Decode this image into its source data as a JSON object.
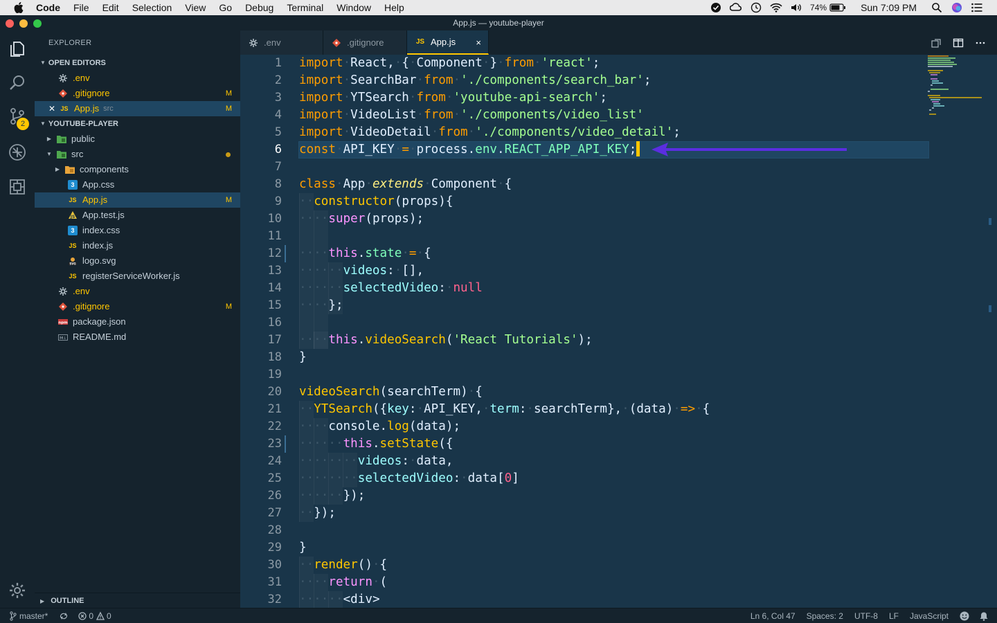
{
  "menubar": {
    "items": [
      "Code",
      "File",
      "Edit",
      "Selection",
      "View",
      "Go",
      "Debug",
      "Terminal",
      "Window",
      "Help"
    ],
    "battery": "74%",
    "clock": "Sun 7:09 PM"
  },
  "window": {
    "title": "App.js — youtube-player"
  },
  "activity_bar": {
    "scm_badge": "2"
  },
  "sidebar": {
    "header": "EXPLORER",
    "open_editors_label": "OPEN EDITORS",
    "open_editors": [
      {
        "name": ".env",
        "icon": "gear-icon",
        "modified": ""
      },
      {
        "name": ".gitignore",
        "icon": "git-icon",
        "modified": "M"
      },
      {
        "name": "App.js",
        "icon": "js-icon",
        "sub": "src",
        "modified": "M"
      }
    ],
    "project_label": "YOUTUBE-PLAYER",
    "tree": [
      {
        "name": "public",
        "icon": "folder-icon",
        "modified": ""
      },
      {
        "name": "src",
        "icon": "folder-icon",
        "modified": ""
      },
      {
        "name": "components",
        "icon": "folder-icon",
        "modified": ""
      },
      {
        "name": "App.css",
        "icon": "css-icon",
        "modified": ""
      },
      {
        "name": "App.js",
        "icon": "js-icon",
        "modified": "M"
      },
      {
        "name": "App.test.js",
        "icon": "test-icon",
        "modified": ""
      },
      {
        "name": "index.css",
        "icon": "css-icon",
        "modified": ""
      },
      {
        "name": "index.js",
        "icon": "js-icon",
        "modified": ""
      },
      {
        "name": "logo.svg",
        "icon": "svg-icon",
        "modified": ""
      },
      {
        "name": "registerServiceWorker.js",
        "icon": "js-icon",
        "modified": ""
      },
      {
        "name": ".env",
        "icon": "gear-icon",
        "modified": ""
      },
      {
        "name": ".gitignore",
        "icon": "git-icon",
        "modified": "M"
      },
      {
        "name": "package.json",
        "icon": "npm-icon",
        "modified": ""
      },
      {
        "name": "README.md",
        "icon": "markdown-icon",
        "modified": ""
      }
    ],
    "outline_label": "OUTLINE"
  },
  "tabs": [
    {
      "label": ".env",
      "icon": "gear-icon"
    },
    {
      "label": ".gitignore",
      "icon": "git-icon"
    },
    {
      "label": "App.js",
      "icon": "js-icon",
      "active": true,
      "close": "×"
    }
  ],
  "editor": {
    "line_numbers": [
      "1",
      "2",
      "3",
      "4",
      "5",
      "6",
      "7",
      "8",
      "9",
      "10",
      "11",
      "12",
      "13",
      "14",
      "15",
      "16",
      "17",
      "18",
      "19",
      "20",
      "21",
      "22",
      "23",
      "24",
      "25",
      "26",
      "27",
      "28",
      "29",
      "30",
      "31",
      "32"
    ],
    "code_lines": [
      "import React, { Component } from 'react';",
      "import SearchBar from './components/search_bar';",
      "import YTSearch from 'youtube-api-search';",
      "import VideoList from './components/video_list'",
      "import VideoDetail from './components/video_detail';",
      "const API_KEY = process.env.REACT_APP_API_KEY;",
      "",
      "class App extends Component {",
      "  constructor(props){",
      "    super(props);",
      "",
      "    this.state = {",
      "      videos: [],",
      "      selectedVideo: null",
      "    };",
      "",
      "    this.videoSearch('React Tutorials');",
      "}",
      "",
      "videoSearch(searchTerm) {",
      "  YTSearch({key: API_KEY, term: searchTerm}, (data) => {",
      "    console.log(data);",
      "      this.setState({",
      "        videos: data,",
      "        selectedVideo: data[0]",
      "      });",
      "  });",
      "",
      "}",
      "  render() {",
      "    return (",
      "      <div>"
    ]
  },
  "statusbar": {
    "branch": "master*",
    "errors": "0",
    "warnings": "0",
    "position": "Ln 6, Col 47",
    "spaces": "Spaces: 2",
    "encoding": "UTF-8",
    "eol": "LF",
    "language": "JavaScript"
  },
  "colors": {
    "editor_bg": "#193549",
    "sidebar_bg": "#15232d",
    "accent": "#ffc600",
    "arrow": "#5b2ee0"
  }
}
